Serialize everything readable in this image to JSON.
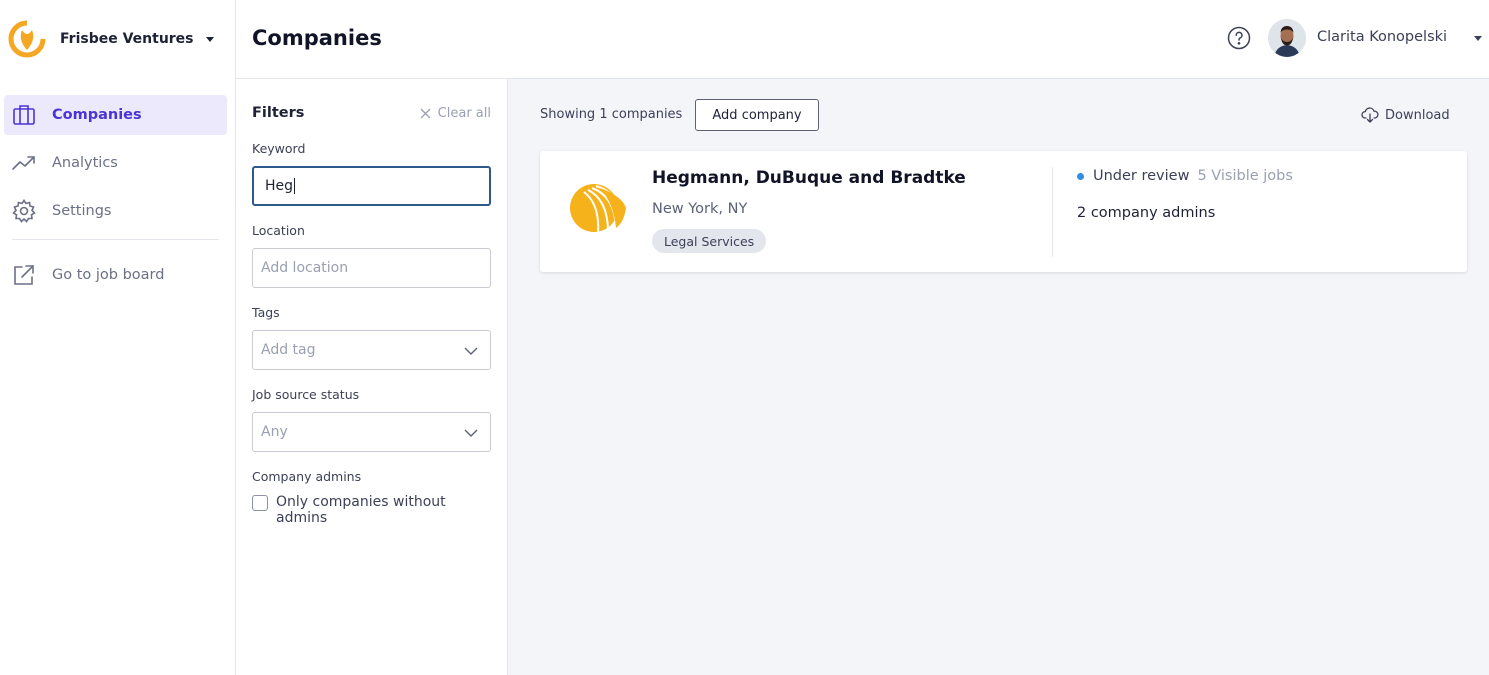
{
  "org": {
    "name": "Frisbee Ventures",
    "logo_color": "#f5a623"
  },
  "nav": {
    "items": [
      {
        "label": "Companies",
        "icon": "briefcase-icon",
        "active": true
      },
      {
        "label": "Analytics",
        "icon": "trend-up-icon",
        "active": false
      },
      {
        "label": "Settings",
        "icon": "gear-icon",
        "active": false
      }
    ],
    "external": {
      "label": "Go to job board",
      "icon": "external-link-icon"
    }
  },
  "header": {
    "title": "Companies",
    "help_icon": "help-circle-icon",
    "user_name": "Clarita Konopelski"
  },
  "filters": {
    "title": "Filters",
    "clear_all": "Clear all",
    "keyword": {
      "label": "Keyword",
      "value": "Heg"
    },
    "location": {
      "label": "Location",
      "placeholder": "Add location"
    },
    "tags": {
      "label": "Tags",
      "placeholder": "Add tag"
    },
    "job_source_status": {
      "label": "Job source status",
      "value": "Any"
    },
    "company_admins": {
      "label": "Company admins",
      "checkbox_label": "Only companies without admins",
      "checked": false
    }
  },
  "main": {
    "showing": "Showing 1 companies",
    "add_company": "Add company",
    "download": "Download"
  },
  "companies": [
    {
      "name": "Hegmann, DuBuque and Bradtke",
      "location": "New York, NY",
      "tag": "Legal Services",
      "status": "Under review",
      "status_color": "#2f8fe0",
      "visible_jobs": "5 Visible jobs",
      "admins": "2 company admins",
      "logo_color": "#f5b21a"
    }
  ],
  "colors": {
    "accent": "#4b34d6",
    "active_bg": "#ece9fc",
    "main_bg": "#f3f5f9"
  }
}
